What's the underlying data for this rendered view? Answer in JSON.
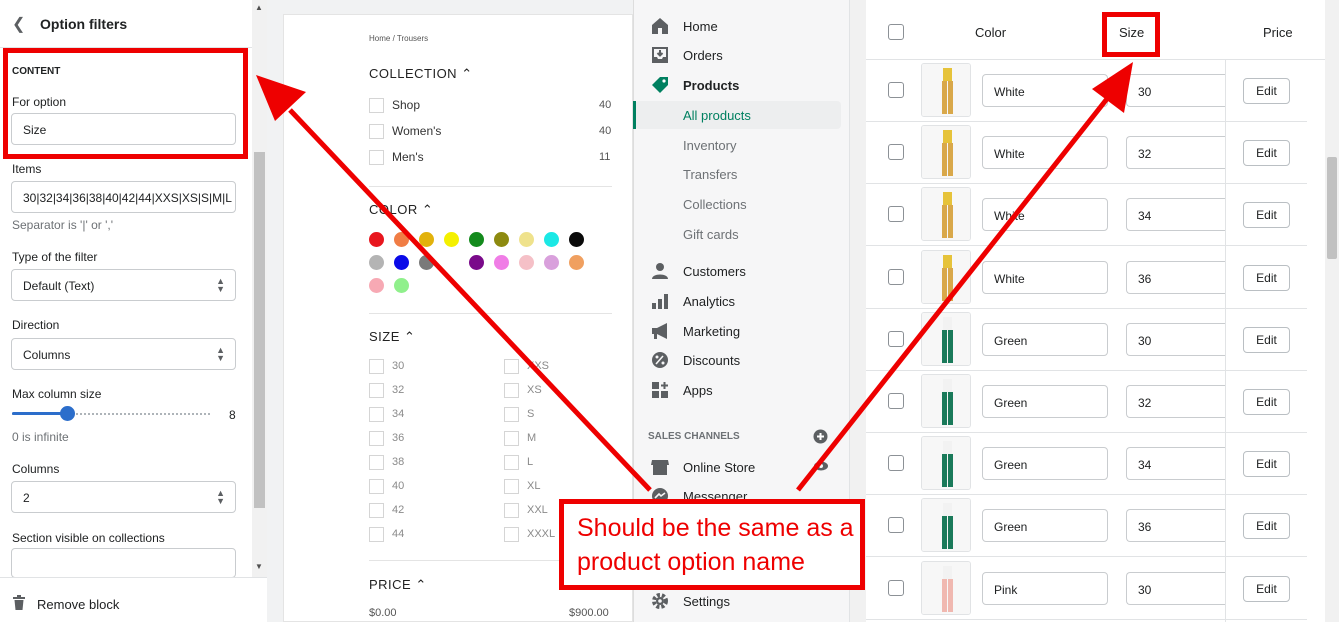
{
  "left_panel": {
    "title": "Option filters",
    "content_heading": "CONTENT",
    "for_option_label": "For option",
    "for_option_value": "Size",
    "items_label": "Items",
    "items_value": "30|32|34|36|38|40|42|44|XXS|XS|S|M|L",
    "items_help": "Separator is '|' or ','",
    "filter_type_label": "Type of the filter",
    "filter_type_value": "Default (Text)",
    "direction_label": "Direction",
    "direction_value": "Columns",
    "max_column_label": "Max column size",
    "max_column_value": "8",
    "max_column_level": 0.28,
    "max_column_help": "0 is infinite",
    "columns_label": "Columns",
    "columns_value": "2",
    "section_visible_label": "Section visible on collections",
    "section_visible_value": "",
    "remove_block": "Remove block"
  },
  "preview": {
    "breadcrumb": "Home  /  Trousers",
    "collection_heading": "COLLECTION",
    "collections": [
      {
        "label": "Shop",
        "count": "40"
      },
      {
        "label": "Women's",
        "count": "40"
      },
      {
        "label": "Men's",
        "count": "11"
      }
    ],
    "color_heading": "COLOR",
    "swatches": [
      "#e8161e",
      "#f07d45",
      "#e2b20c",
      "#f4f000",
      "#138a1c",
      "#8d8a10",
      "#efe28c",
      "#1be8e5",
      "#0a0a0a",
      "#b4b4b4",
      "#0a0ae8",
      "#7a7a7a",
      "#ffffff",
      "#7a0a8a",
      "#f07de6",
      "#f5c0c7",
      "#d9a0dc",
      "#f0a060",
      "#f7a9b4",
      "#90f08c"
    ],
    "size_heading": "SIZE",
    "sizes_left": [
      "30",
      "32",
      "34",
      "36",
      "38",
      "40",
      "42",
      "44"
    ],
    "sizes_right": [
      "XXS",
      "XS",
      "S",
      "M",
      "L",
      "XL",
      "XXL",
      "XXXL"
    ],
    "price_heading": "PRICE",
    "price_min": "$0.00",
    "price_max": "$900.00"
  },
  "nav": {
    "home": "Home",
    "orders": "Orders",
    "products": "Products",
    "all_products": "All products",
    "inventory": "Inventory",
    "transfers": "Transfers",
    "collections": "Collections",
    "gift_cards": "Gift cards",
    "customers": "Customers",
    "analytics": "Analytics",
    "marketing": "Marketing",
    "discounts": "Discounts",
    "apps": "Apps",
    "sales_channels": "SALES CHANNELS",
    "online_store": "Online Store",
    "messenger": "Messenger",
    "settings": "Settings"
  },
  "table": {
    "col_color": "Color",
    "col_size": "Size",
    "col_price": "Price",
    "edit_label": "Edit",
    "rows": [
      {
        "color": "White",
        "size": "30",
        "thumb": "white"
      },
      {
        "color": "White",
        "size": "32",
        "thumb": "white"
      },
      {
        "color": "White",
        "size": "34",
        "thumb": "white"
      },
      {
        "color": "White",
        "size": "36",
        "thumb": "white"
      },
      {
        "color": "Green",
        "size": "30",
        "thumb": "green"
      },
      {
        "color": "Green",
        "size": "32",
        "thumb": "green"
      },
      {
        "color": "Green",
        "size": "34",
        "thumb": "green"
      },
      {
        "color": "Green",
        "size": "36",
        "thumb": "green"
      },
      {
        "color": "Pink",
        "size": "30",
        "thumb": "pink"
      }
    ]
  },
  "annotation": {
    "callout_text": "Should be the same as a product option name",
    "color": "#ee0000"
  }
}
